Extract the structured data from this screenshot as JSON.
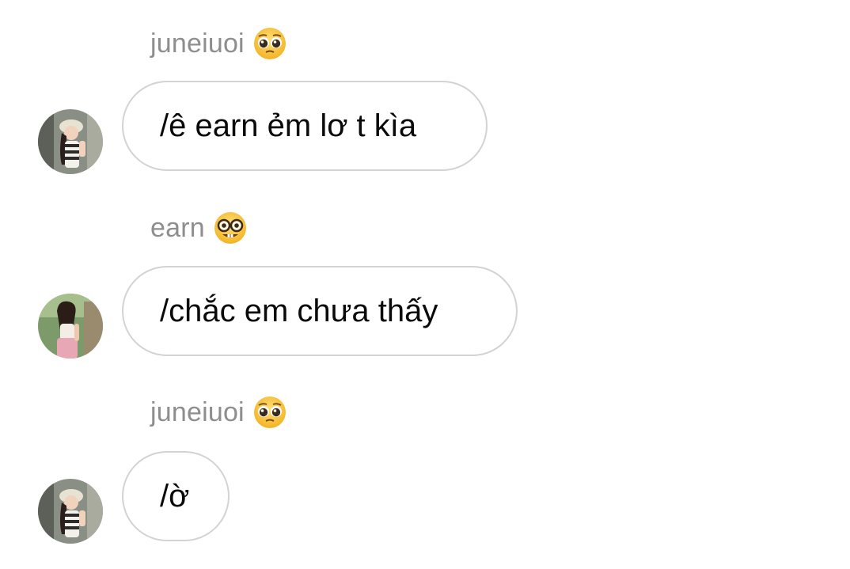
{
  "messages": [
    {
      "sender": "juneiuoi",
      "sender_emoji": "pleading-face-icon",
      "avatar": "avatar-girl-hat",
      "text": "/ê earn ẻm lơ t kìa"
    },
    {
      "sender": "earn",
      "sender_emoji": "nerd-face-icon",
      "avatar": "avatar-girl-pink",
      "text": "/chắc em chưa thấy"
    },
    {
      "sender": "juneiuoi",
      "sender_emoji": "pleading-face-icon",
      "avatar": "avatar-girl-hat",
      "text": "/ờ"
    }
  ],
  "colors": {
    "sender_name": "#8e8e8e",
    "bubble_border": "#d3d3d3",
    "message_text": "#0a0a0a",
    "emoji_face": "#f7c13a"
  }
}
